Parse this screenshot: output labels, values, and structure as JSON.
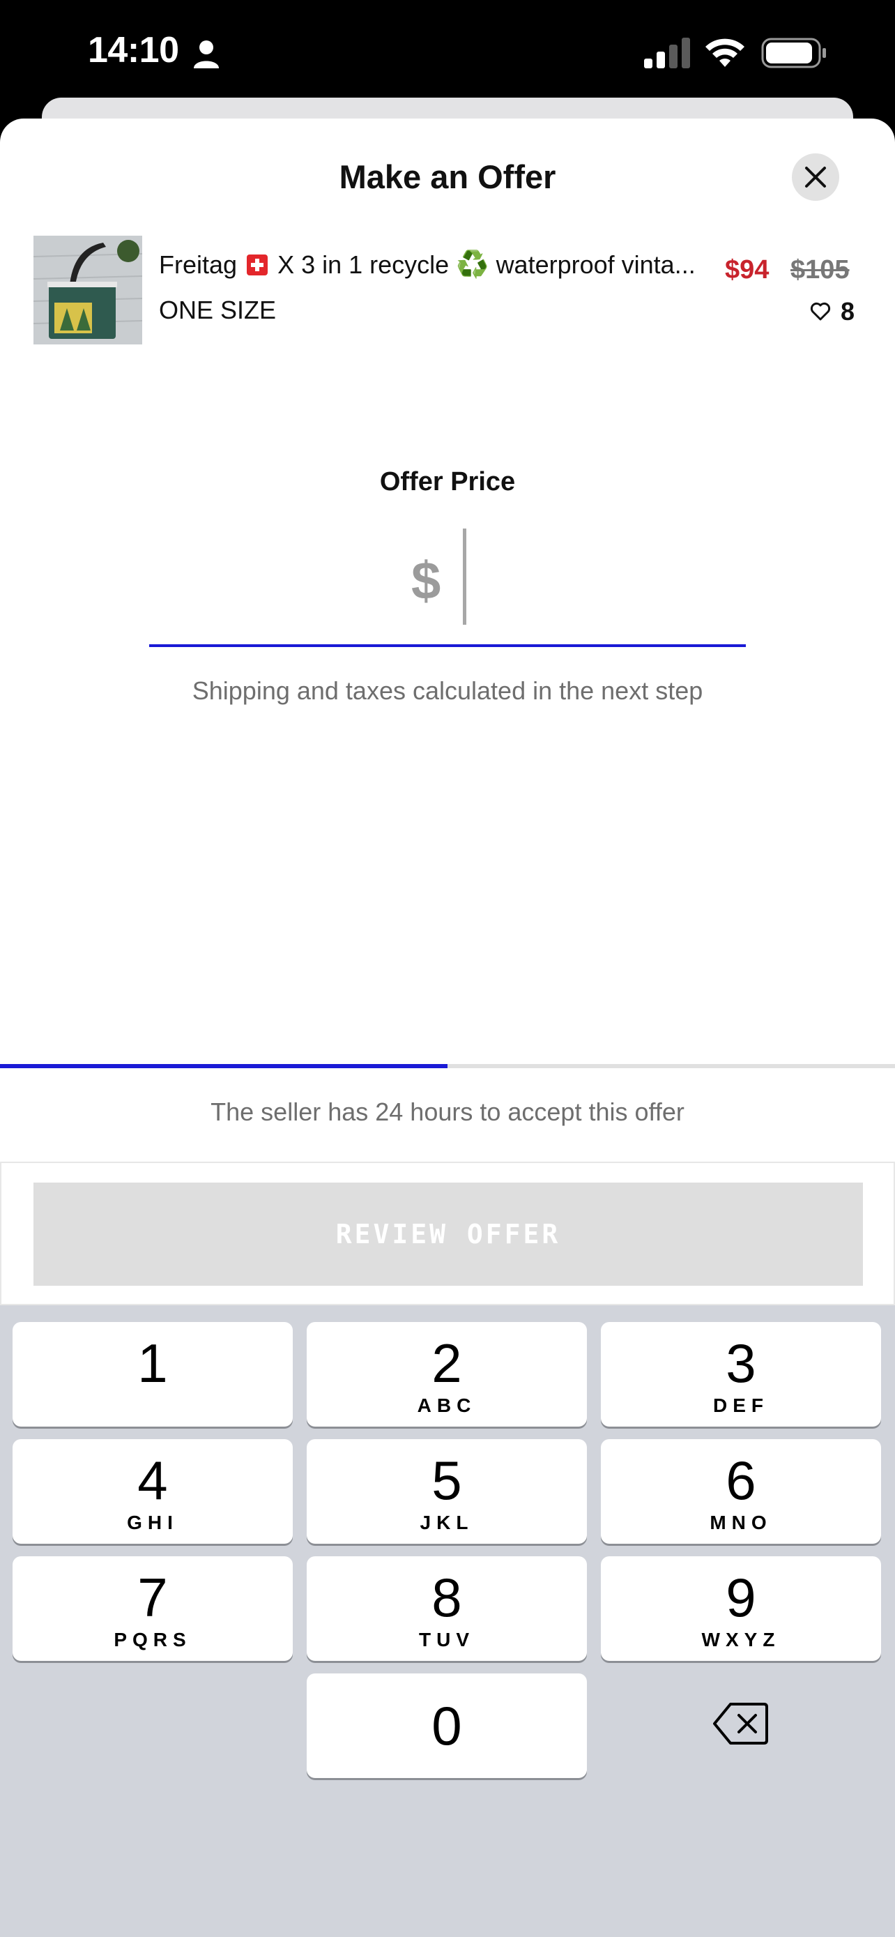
{
  "status_bar": {
    "time": "14:10"
  },
  "sheet": {
    "title": "Make an Offer"
  },
  "product": {
    "title_part1": "Freitag",
    "title_part2": "X 3 in 1 recycle",
    "title_part3": "waterproof vinta...",
    "recycle_glyph": "♻️",
    "size": "ONE SIZE",
    "sale_price": "$94",
    "original_price": "$105",
    "likes": "8"
  },
  "offer": {
    "label": "Offer Price",
    "currency_symbol": "$",
    "shipping_note": "Shipping and taxes calculated in the next step",
    "step_progress": 0.5,
    "seller_note": "The seller has 24 hours to accept this offer",
    "review_button": "REVIEW OFFER"
  },
  "keypad": {
    "keys": [
      {
        "digit": "1",
        "letters": ""
      },
      {
        "digit": "2",
        "letters": "ABC"
      },
      {
        "digit": "3",
        "letters": "DEF"
      },
      {
        "digit": "4",
        "letters": "GHI"
      },
      {
        "digit": "5",
        "letters": "JKL"
      },
      {
        "digit": "6",
        "letters": "MNO"
      },
      {
        "digit": "7",
        "letters": "PQRS"
      },
      {
        "digit": "8",
        "letters": "TUV"
      },
      {
        "digit": "9",
        "letters": "WXYZ"
      },
      {
        "digit": "0",
        "letters": ""
      }
    ]
  },
  "colors": {
    "accent_blue": "#1a1ad6",
    "sale_red": "#c8232c",
    "keyboard_bg": "#d1d4db"
  }
}
